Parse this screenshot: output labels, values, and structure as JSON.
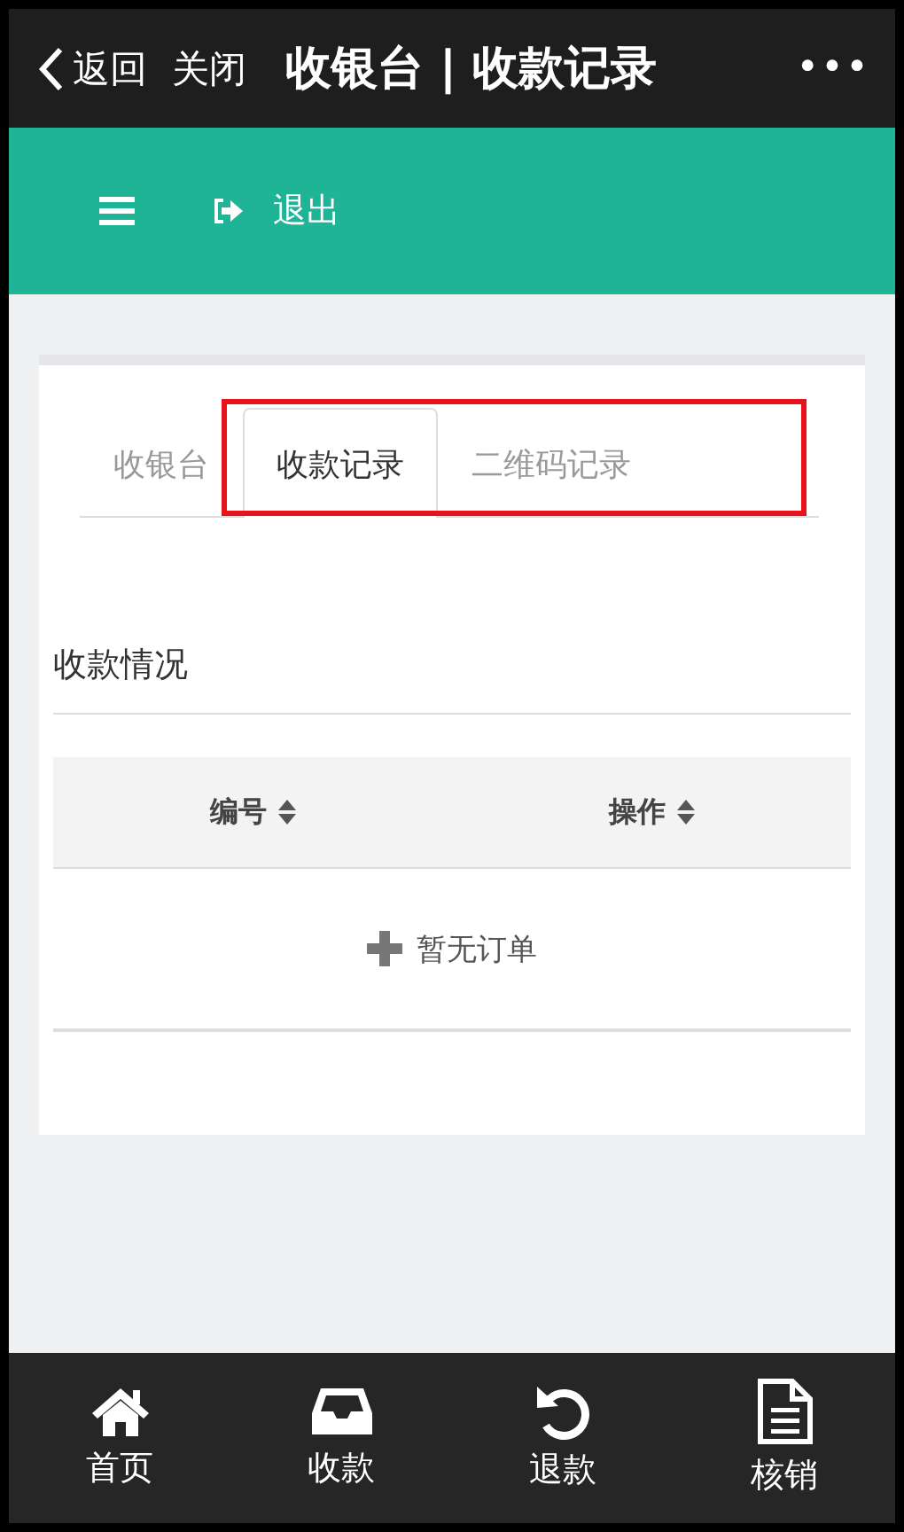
{
  "title_bar": {
    "back": "返回",
    "close": "关闭",
    "title": "收银台 | 收款记录",
    "more": "•••"
  },
  "toolbar": {
    "logout": "退出"
  },
  "tabs": [
    {
      "label": "收银台",
      "selected": false
    },
    {
      "label": "收款记录",
      "selected": true
    },
    {
      "label": "二维码记录",
      "selected": false
    }
  ],
  "section": {
    "title": "收款情况"
  },
  "table": {
    "columns": [
      "编号",
      "操作"
    ],
    "empty_text": "暂无订单"
  },
  "bottom_nav": [
    {
      "label": "首页",
      "kind": "home"
    },
    {
      "label": "收款",
      "kind": "inbox"
    },
    {
      "label": "退款",
      "kind": "undo"
    },
    {
      "label": "核销",
      "kind": "file"
    }
  ]
}
